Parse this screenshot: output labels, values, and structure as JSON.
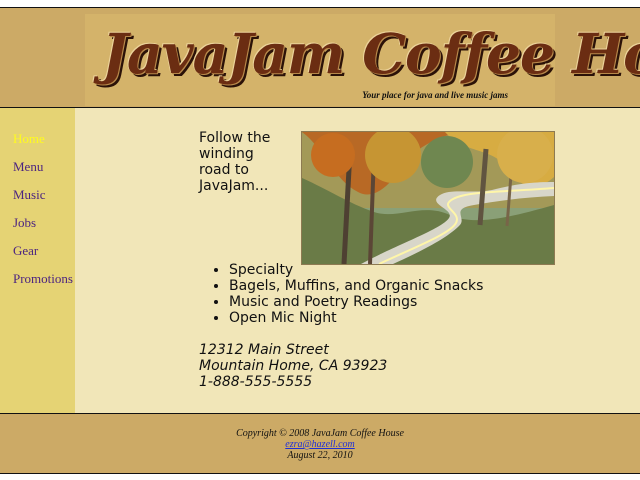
{
  "header": {
    "logo_text": "JavaJam Coffee House",
    "tagline": "Your place for java and live music jams"
  },
  "navigation": {
    "items": [
      {
        "label": "Home",
        "active": true
      },
      {
        "label": "Menu",
        "active": false
      },
      {
        "label": "Music",
        "active": false
      },
      {
        "label": "Jobs",
        "active": false
      },
      {
        "label": "Gear",
        "active": false
      },
      {
        "label": "Promotions",
        "active": false
      }
    ]
  },
  "main": {
    "intro_text": "Follow the winding road to JavaJam...",
    "features": [
      "Specialty",
      "Bagels, Muffins, and Organic Snacks",
      "Music and Poetry Readings",
      "Open Mic Night"
    ],
    "address": {
      "street": "12312 Main Street",
      "city_state_zip": "Mountain Home, CA 93923",
      "phone": "1-888-555-5555"
    }
  },
  "footer": {
    "copyright": "Copyright © 2008 JavaJam Coffee House",
    "email": "ezra@hazell.com",
    "email_href": "mailto:ezra@hazell.com",
    "date": "August 22, 2010"
  },
  "colors": {
    "header_background": "#ccaa66",
    "sidebar_background": "#e5d374",
    "content_background": "#f1e6b8",
    "navigation_text": "#4c2480",
    "active_navigation": "#fffb1f"
  },
  "icons": {
    "feature_bullet": "bullet-icon",
    "hero_image": "winding-road-image"
  }
}
